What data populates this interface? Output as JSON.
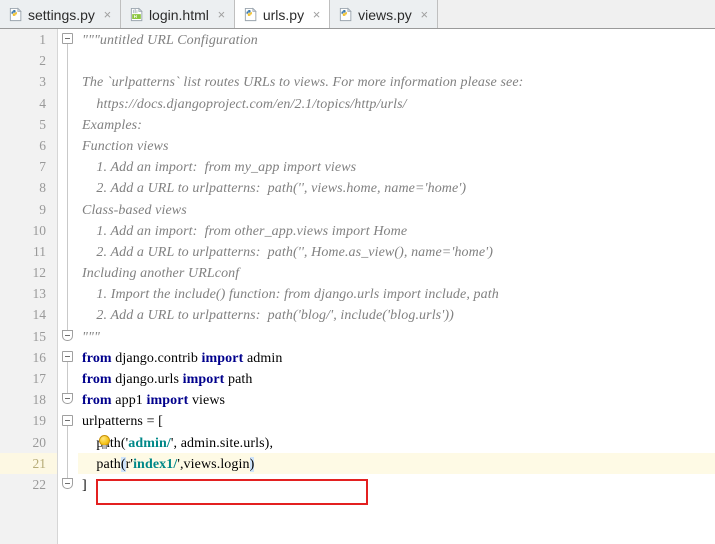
{
  "window": {
    "app": "pycharm-editor",
    "accent_red": "#e32020",
    "highlight_line_bg": "#fefae5",
    "bracket_match_bg": "#cfe4fb",
    "keyword_color": "#00008c",
    "string_color": "#008888",
    "docstring_color": "#808080"
  },
  "tabs": [
    {
      "label": "settings.py",
      "icon": "python-file-icon",
      "close": "×",
      "active": false
    },
    {
      "label": "login.html",
      "icon": "html-file-icon",
      "close": "×",
      "active": false
    },
    {
      "label": "urls.py",
      "icon": "python-file-icon",
      "close": "×",
      "active": true
    },
    {
      "label": "views.py",
      "icon": "python-file-icon",
      "close": "×",
      "active": false
    }
  ],
  "editor": {
    "file": "urls.py",
    "gutter_numbers": [
      "1",
      "2",
      "3",
      "4",
      "5",
      "6",
      "7",
      "8",
      "9",
      "10",
      "11",
      "12",
      "13",
      "14",
      "15",
      "16",
      "17",
      "18",
      "19",
      "20",
      "21",
      "22"
    ],
    "highlighted_line": "21",
    "bulb_line": "20",
    "bulb_icon": "intention-bulb-icon",
    "lines": [
      {
        "n": "1",
        "text": "\"\"\"untitled URL Configuration",
        "style": "doc"
      },
      {
        "n": "2",
        "text": "",
        "style": "doc"
      },
      {
        "n": "3",
        "text": "The `urlpatterns` list routes URLs to views. For more information please see:",
        "style": "doc"
      },
      {
        "n": "4",
        "text": "    https://docs.djangoproject.com/en/2.1/topics/http/urls/",
        "style": "doc"
      },
      {
        "n": "5",
        "text": "Examples:",
        "style": "doc"
      },
      {
        "n": "6",
        "text": "Function views",
        "style": "doc"
      },
      {
        "n": "7",
        "text": "    1. Add an import:  from my_app import views",
        "style": "doc"
      },
      {
        "n": "8",
        "text": "    2. Add a URL to urlpatterns:  path('', views.home, name='home')",
        "style": "doc"
      },
      {
        "n": "9",
        "text": "Class-based views",
        "style": "doc"
      },
      {
        "n": "10",
        "text": "    1. Add an import:  from other_app.views import Home",
        "style": "doc"
      },
      {
        "n": "11",
        "text": "    2. Add a URL to urlpatterns:  path('', Home.as_view(), name='home')",
        "style": "doc"
      },
      {
        "n": "12",
        "text": "Including another URLconf",
        "style": "doc"
      },
      {
        "n": "13",
        "text": "    1. Import the include() function: from django.urls import include, path",
        "style": "doc"
      },
      {
        "n": "14",
        "text": "    2. Add a URL to urlpatterns:  path('blog/', include('blog.urls'))",
        "style": "doc"
      },
      {
        "n": "15",
        "text": "\"\"\"",
        "style": "doc"
      },
      {
        "n": "16",
        "text": "from django.contrib import admin",
        "style": "code"
      },
      {
        "n": "17",
        "text": "from django.urls import path",
        "style": "code"
      },
      {
        "n": "18",
        "text": "from app1 import views",
        "style": "code"
      },
      {
        "n": "19",
        "text": "urlpatterns = [",
        "style": "code"
      },
      {
        "n": "20",
        "text": "    path('admin/', admin.site.urls),",
        "style": "code"
      },
      {
        "n": "21",
        "text": "    path(r'index1/',views.login)",
        "style": "code"
      },
      {
        "n": "22",
        "text": "]",
        "style": "code"
      }
    ],
    "annotation": {
      "name": "red-highlight-box",
      "target_line": "21",
      "color": "#e32020"
    }
  }
}
